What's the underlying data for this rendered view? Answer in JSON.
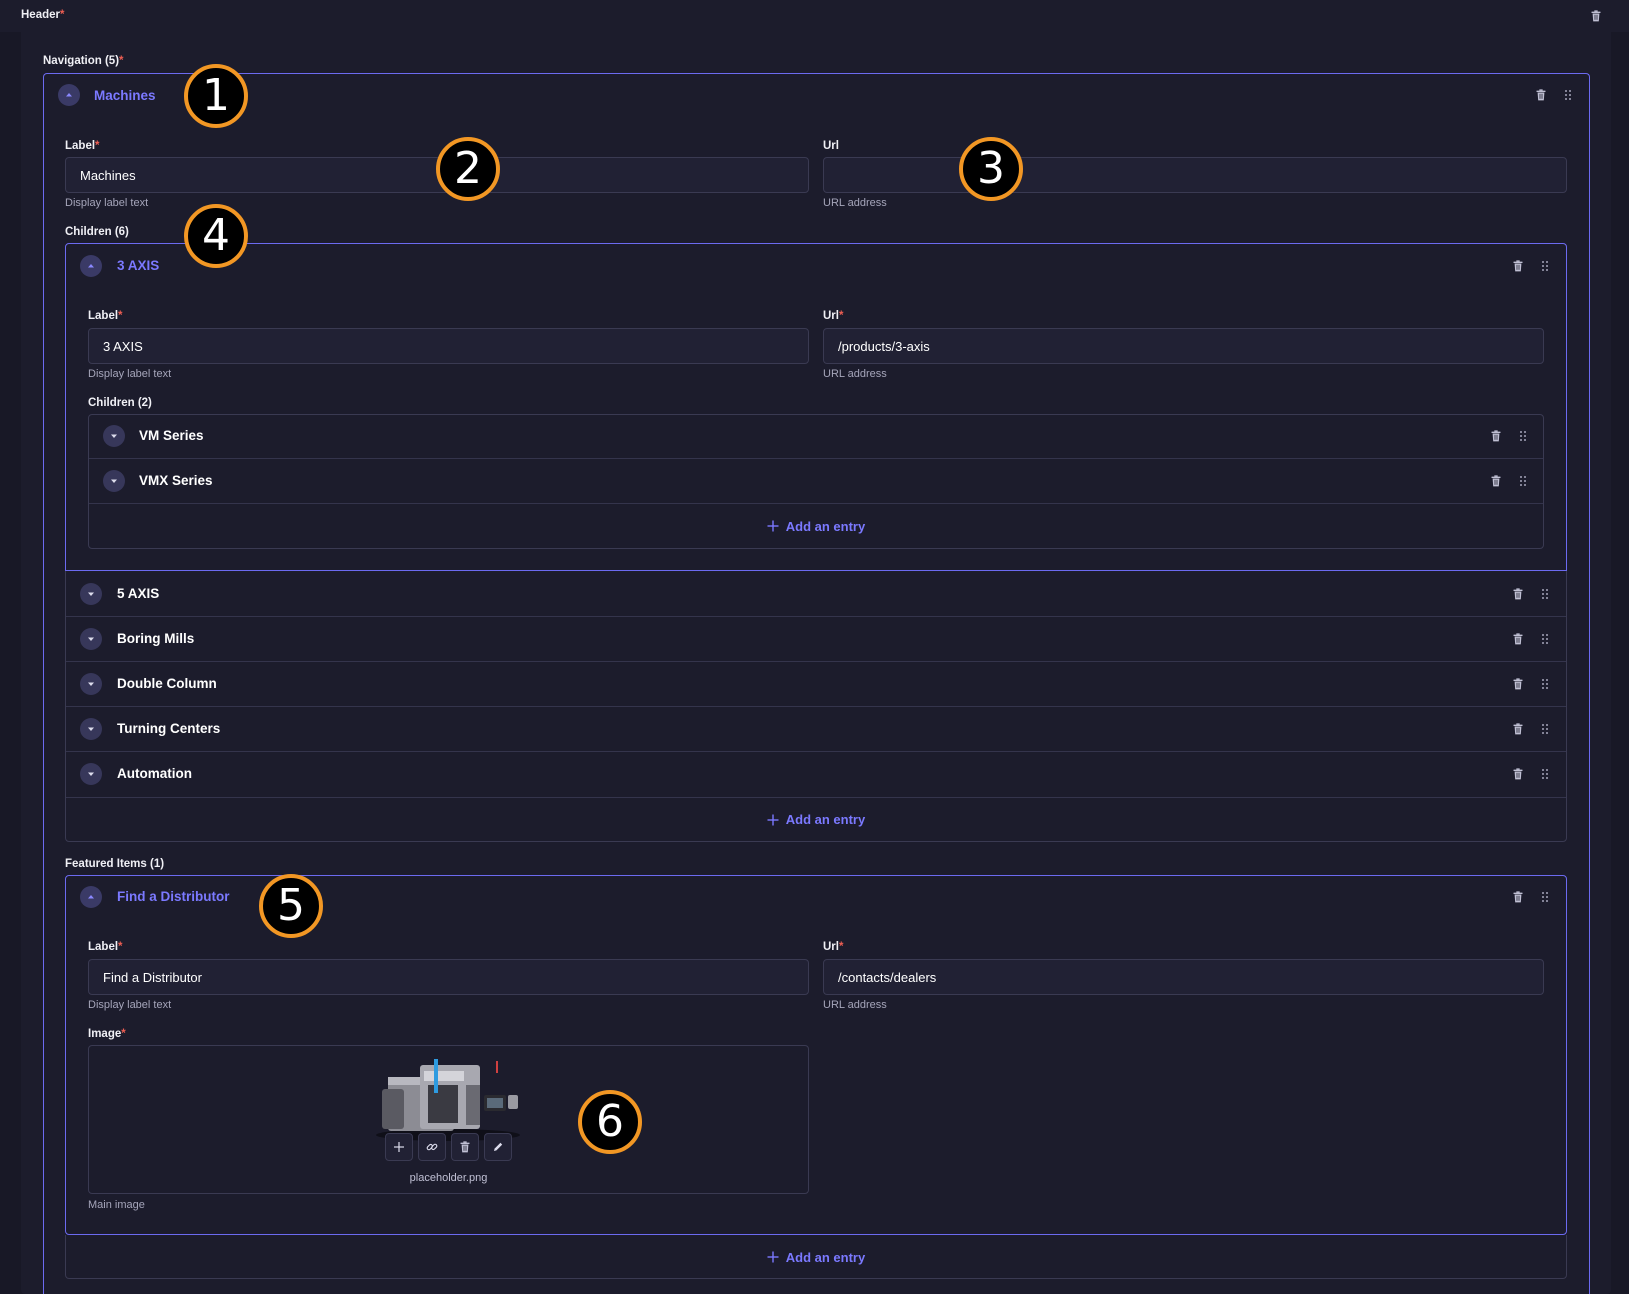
{
  "header": {
    "title": "Header",
    "required": "*"
  },
  "navigation": {
    "title": "Navigation (5)",
    "required": "*",
    "item": {
      "title": "Machines",
      "label_field": {
        "label": "Label",
        "required": "*",
        "value": "Machines",
        "hint": "Display label text"
      },
      "url_field": {
        "label": "Url",
        "value": "",
        "hint": "URL address"
      },
      "children": {
        "title": "Children (6)",
        "open_item": {
          "title": "3 AXIS",
          "label_field": {
            "label": "Label",
            "required": "*",
            "value": "3 AXIS",
            "hint": "Display label text"
          },
          "url_field": {
            "label": "Url",
            "required": "*",
            "value": "/products/3-axis",
            "hint": "URL address"
          },
          "children": {
            "title": "Children (2)",
            "items": [
              {
                "label": "VM Series"
              },
              {
                "label": "VMX Series"
              }
            ],
            "add_label": "Add an entry"
          }
        },
        "items": [
          {
            "label": "5 AXIS"
          },
          {
            "label": "Boring Mills"
          },
          {
            "label": "Double Column"
          },
          {
            "label": "Turning Centers"
          },
          {
            "label": "Automation"
          }
        ],
        "add_label": "Add an entry"
      },
      "featured": {
        "title": "Featured Items (1)",
        "item": {
          "title": "Find a Distributor",
          "label_field": {
            "label": "Label",
            "required": "*",
            "value": "Find a Distributor",
            "hint": "Display label text"
          },
          "url_field": {
            "label": "Url",
            "required": "*",
            "value": "/contacts/dealers",
            "hint": "URL address"
          },
          "image_field": {
            "label": "Image",
            "required": "*",
            "filename": "placeholder.png",
            "hint": "Main image"
          }
        },
        "add_label": "Add an entry"
      }
    }
  },
  "annotations": [
    "1",
    "2",
    "3",
    "4",
    "5",
    "6"
  ],
  "colors": {
    "accent": "#7b79ff",
    "required": "#ee5e52",
    "badge_ring": "#f29724",
    "background": "#181826"
  },
  "icons": {
    "delete": "trash-icon",
    "drag": "drag-handle-icon",
    "expand": "chevron-down-icon",
    "collapse": "chevron-up-icon",
    "add": "plus-icon",
    "link": "link-icon",
    "edit": "pencil-icon"
  }
}
